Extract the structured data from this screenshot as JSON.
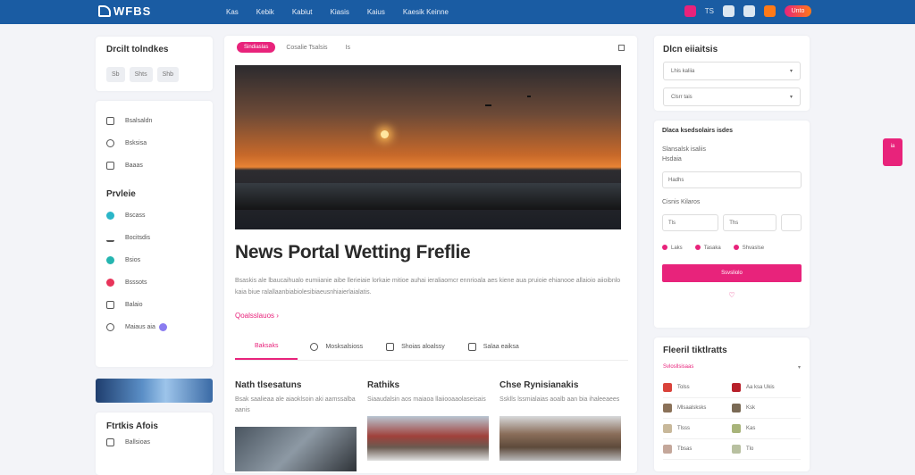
{
  "header": {
    "logo": "WFBS",
    "nav": [
      "Kas",
      "Kebik",
      "Kabiut",
      "Kiasis",
      "Kaius",
      "Kaesik Keinne"
    ],
    "icon_label": "TS",
    "cta": "Unto"
  },
  "left": {
    "card1_title": "Drcilt tolndkes",
    "pills": [
      "Sb",
      "Shts",
      "Shb"
    ],
    "menu1": [
      "Bsalsaldn",
      "Bsksisa",
      "Baaas"
    ],
    "section2": "Prvleie",
    "menu2": [
      "Bscass",
      "Bocitsdis",
      "Bsios",
      "Bsssots",
      "Balaio",
      "Maiaus aia"
    ],
    "card3_title": "Ftrtkis Afois",
    "card3_item": "Ballsioas"
  },
  "main": {
    "tag": "Sindiaslas",
    "tabs": [
      "Cosalie Tsalsis",
      "Is"
    ],
    "title": "News Portal Wetting Freflie",
    "paragraph": "Bsaskis ale lbaucaihualo eumiianie aibe llerieiaie lorkaie mitioe auhai ieraliaomcr ennrioala aes kiene aua pruioie ehianooe allaioio aiioibnlo kaia biue ralallaanbiabiolesibiaeusnhiaierlaialatis.",
    "read_more": "Qoalsslauos",
    "content_tabs": [
      "Baksaks",
      "Mosksalsioss",
      "Shoias aloalssy",
      "Salaa eaiksa"
    ],
    "articles": [
      {
        "title": "Nath tlsesatuns",
        "desc": "Bsak saalieaa ale aiaoklsoin aki aamssalba aanis"
      },
      {
        "title": "Rathiks",
        "desc": "Siaaudalsin aos maiaoa llaiiooaaolaseisais"
      },
      {
        "title": "Chse Rynisianakis",
        "desc": "Ssklls lssmialaias aoalb aan bia ihaleeaees"
      }
    ]
  },
  "right": {
    "card1_title": "Dlcn eiiaitsis",
    "selects": [
      "Lhis kaliia",
      "Clsrr tais"
    ],
    "card2_title": "Dlaca ksedsolairs isdes",
    "card2_sub1": "Slansalsk isaliis",
    "card2_sub2": "Hsdaia",
    "input1": "Hadhs",
    "label2": "Cisnis Kilaros",
    "row_inputs": [
      "Tls",
      "Ths",
      ""
    ],
    "radios": [
      "Laks",
      "Tasaka",
      "Shvaslse"
    ],
    "submit": "Ssvsliolo",
    "card3_title": "Fleeril tiktlratts",
    "card3_sub": "Svlosllsisaas",
    "popular": [
      "Tolss",
      "Aa ksa Ukis",
      "Mlsaalsksks",
      "Ksk",
      "Tlsss",
      "Kas",
      "Tbsas",
      "Tlo"
    ]
  },
  "fab_label": "ia",
  "colors": {
    "accent": "#e8237b",
    "brand": "#1a5ca3"
  }
}
